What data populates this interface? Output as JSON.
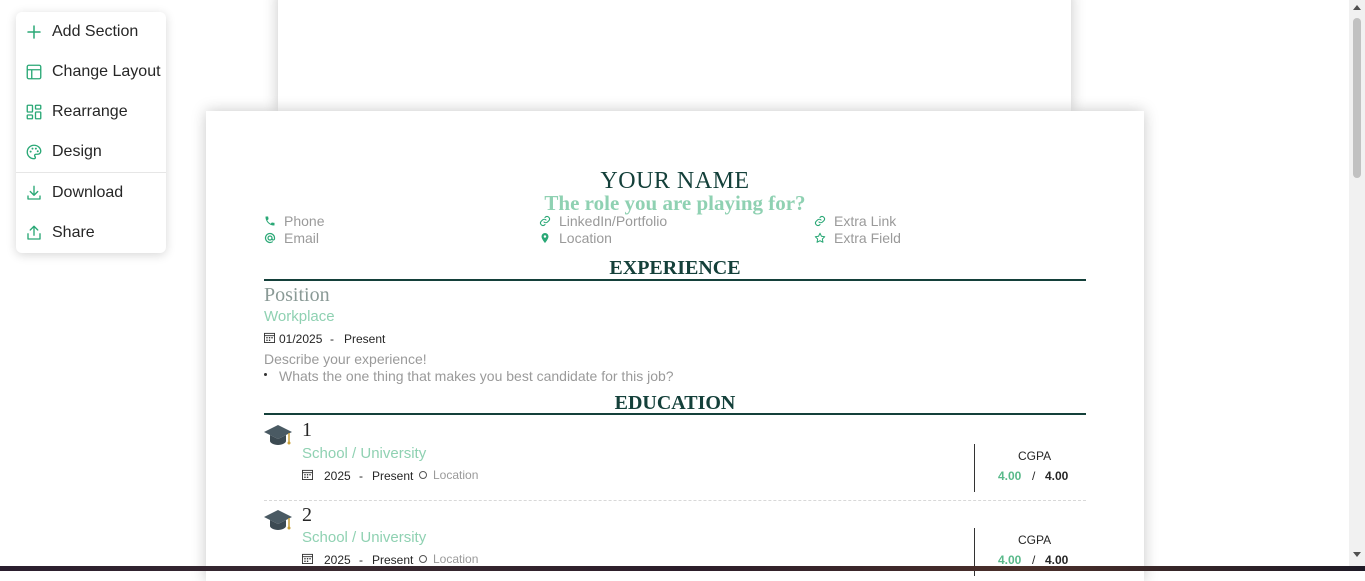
{
  "menu": {
    "items": [
      {
        "label": "Add Section",
        "icon": "plus-icon"
      },
      {
        "label": "Change Layout",
        "icon": "layout-icon"
      },
      {
        "label": "Rearrange",
        "icon": "rearrange-icon"
      },
      {
        "label": "Design",
        "icon": "palette-icon"
      },
      {
        "label": "Download",
        "icon": "download-icon"
      },
      {
        "label": "Share",
        "icon": "share-icon"
      }
    ]
  },
  "resume": {
    "name": "YOUR NAME",
    "role": "The role you are playing for?",
    "contacts": {
      "phone": "Phone",
      "email": "Email",
      "linkedin": "LinkedIn/Portfolio",
      "location": "Location",
      "extra_link": "Extra Link",
      "extra_field": "Extra Field"
    },
    "experience": {
      "title": "EXPERIENCE",
      "position": "Position",
      "workplace": "Workplace",
      "start": "01/2025",
      "dash": "-",
      "end": "Present",
      "description": "Describe your experience!",
      "bullet": "Whats the one thing that makes you best candidate for this job?"
    },
    "education": {
      "title": "EDUCATION",
      "entries": [
        {
          "number": "1",
          "school": "School / University",
          "start": "2025",
          "dash": "-",
          "end": "Present",
          "location": "Location",
          "gpa_label": "CGPA",
          "gpa": "4.00",
          "slash": "/",
          "gpa_max": "4.00"
        },
        {
          "number": "2",
          "school": "School / University",
          "start": "2025",
          "dash": "-",
          "end": "Present",
          "location": "Location",
          "gpa_label": "CGPA",
          "gpa": "4.00",
          "slash": "/",
          "gpa_max": "4.00"
        }
      ]
    }
  },
  "colors": {
    "accent": "#2aa876",
    "heading": "#14403a",
    "role": "#8fd1b2"
  }
}
